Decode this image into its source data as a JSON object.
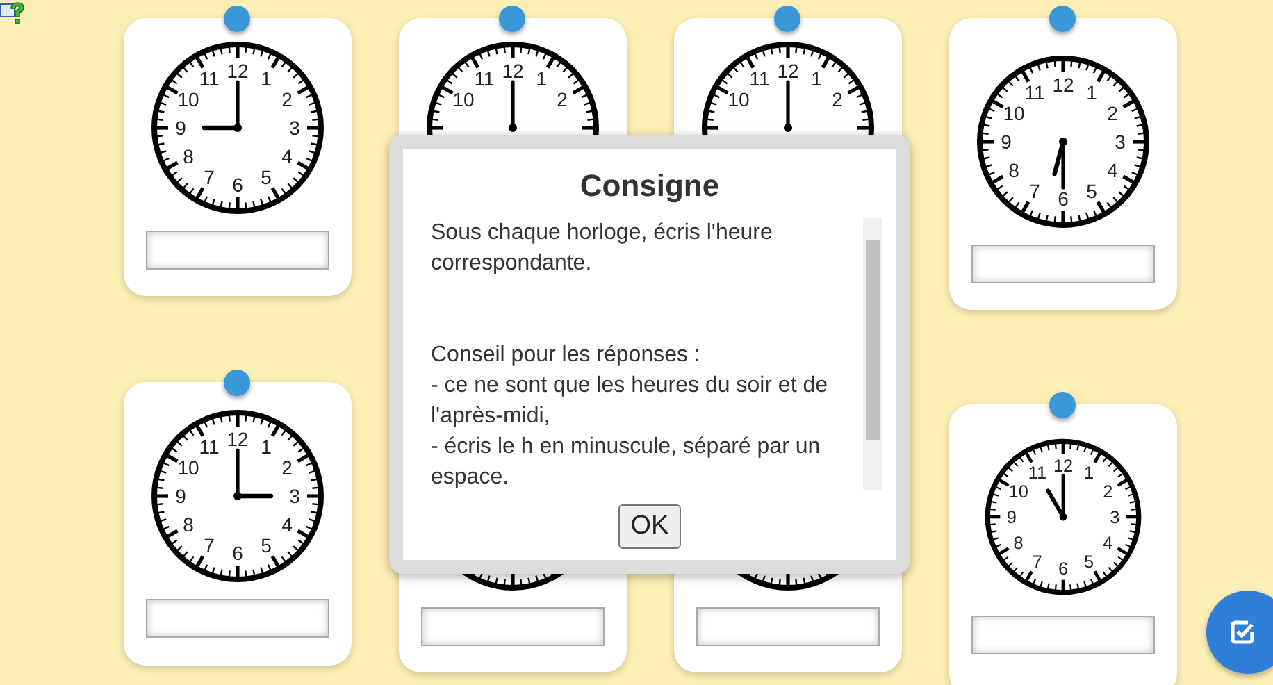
{
  "cards": [
    {
      "kind": "clock",
      "numerals": [
        "12",
        "11",
        "1",
        "10",
        "2",
        "9",
        "3",
        "8",
        "4",
        "7",
        "5",
        "6"
      ]
    },
    {
      "kind": "clock",
      "numerals": [
        "12",
        "11",
        "1",
        "10",
        "2"
      ]
    },
    {
      "kind": "clock",
      "numerals": [
        "12",
        "11",
        "1",
        "10",
        "2"
      ]
    },
    {
      "kind": "clock",
      "numerals": [
        "12",
        "11",
        "1",
        "10",
        "2",
        "9",
        "3",
        "8",
        "4",
        "7",
        "5",
        "6"
      ]
    },
    {
      "kind": "clock",
      "numerals": [
        "12",
        "11",
        "1",
        "10",
        "2",
        "9",
        "3",
        "8",
        "4",
        "7",
        "5",
        "6"
      ]
    },
    {
      "kind": "covered"
    },
    {
      "kind": "covered"
    },
    {
      "kind": "clock",
      "numerals": [
        "12",
        "11",
        "1",
        "10",
        "2",
        "9",
        "3",
        "8",
        "4",
        "7",
        "5",
        "6"
      ]
    }
  ],
  "dialog": {
    "title": "Consigne",
    "blocks": [
      {
        "lines": [
          "Sous chaque horloge, écris l'heure correspondante."
        ]
      },
      {
        "lines": [
          "Conseil pour les réponses :",
          "- ce ne sont que les heures du soir et de l'après-midi,",
          "- écris le h en minuscule, séparé par un espace."
        ]
      }
    ],
    "ok_button": "OK"
  }
}
